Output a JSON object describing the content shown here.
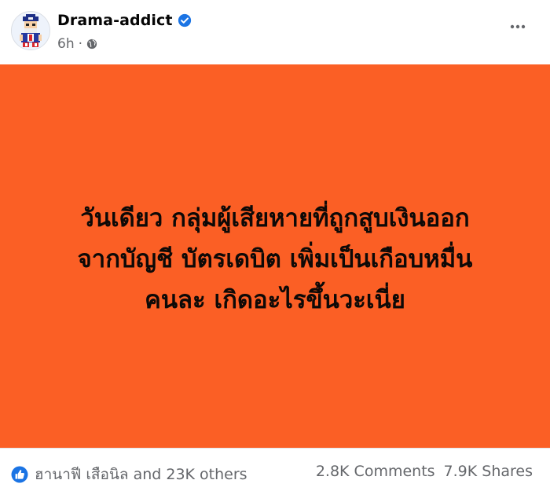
{
  "post": {
    "author": "Drama-addict",
    "time": "6h",
    "separator": "·",
    "verified_icon": "verified-badge-icon",
    "privacy_icon": "globe-icon",
    "more_icon": "more-options-icon"
  },
  "image": {
    "background": "#fb5f25",
    "lines": [
      "วันเดียว กลุ่มผู้เสียหายที่ถูกสูบเงินออก",
      "จากบัญชี บัตรเดบิต เพิ่มเป็นเกือบหมื่น",
      "คนละ เกิดอะไรขึ้นวะเนี่ย"
    ]
  },
  "footer": {
    "reactions_text": "ฮานาฟี เสือนิล and 23K others",
    "comments": "2.8K Comments",
    "shares": "7.9K Shares",
    "reaction_icon": "like-icon"
  },
  "colors": {
    "accent": "#1b74e4",
    "meta_text": "#65676b"
  }
}
